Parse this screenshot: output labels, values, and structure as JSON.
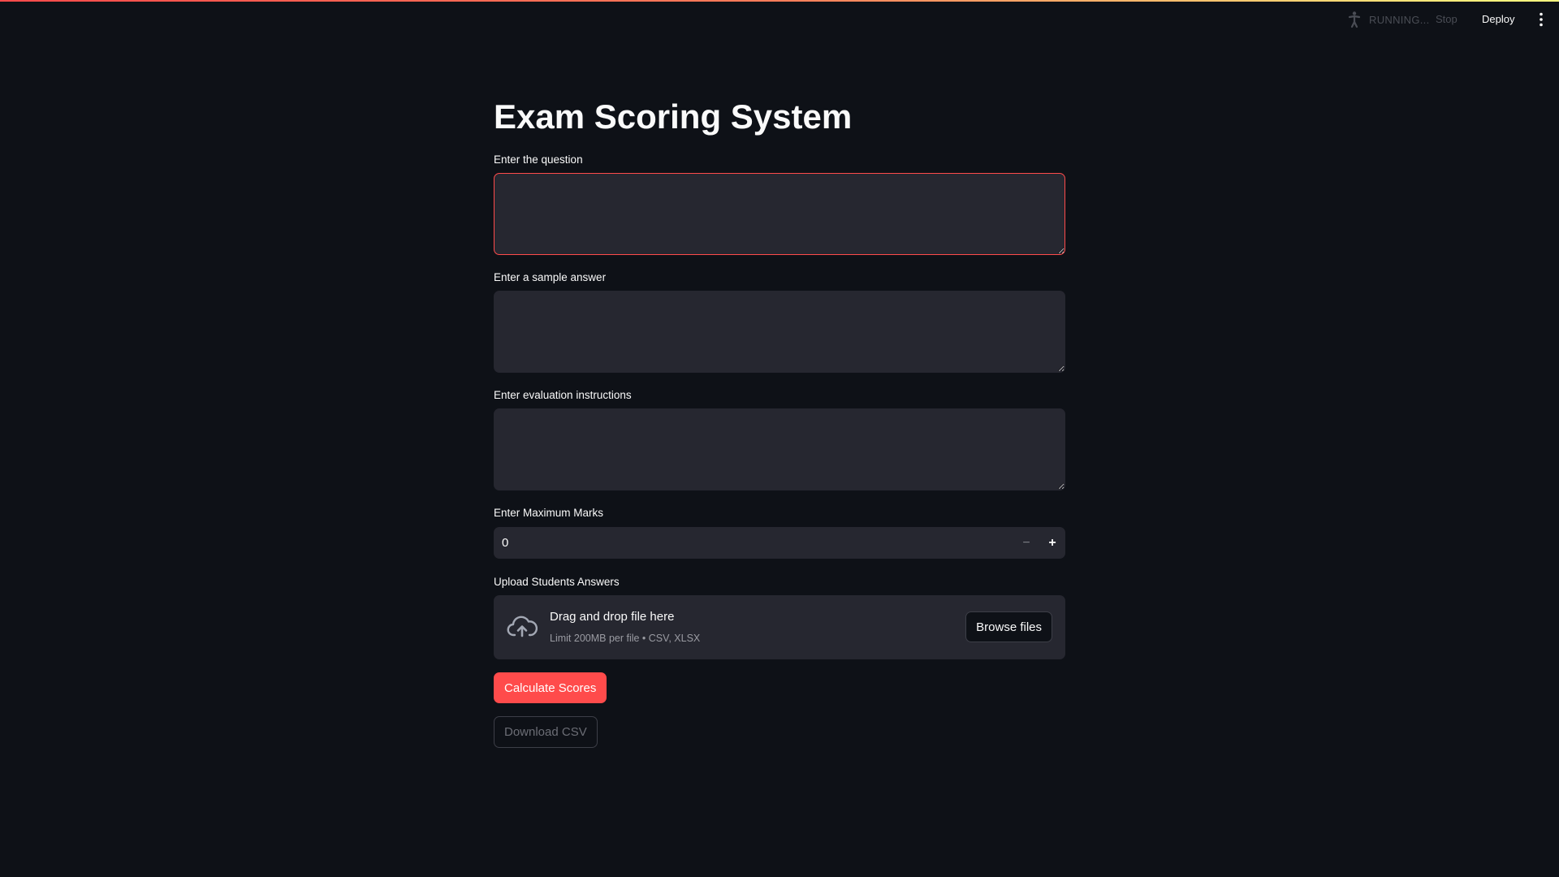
{
  "header": {
    "status_text": "RUNNING...",
    "stop_label": "Stop",
    "deploy_label": "Deploy",
    "status_icon": "running-person-icon",
    "menu_icon": "vertical-ellipsis-icon"
  },
  "main": {
    "title": "Exam Scoring System",
    "question": {
      "label": "Enter the question",
      "value": ""
    },
    "sample_answer": {
      "label": "Enter a sample answer",
      "value": ""
    },
    "instructions": {
      "label": "Enter evaluation instructions",
      "value": ""
    },
    "max_marks": {
      "label": "Enter Maximum Marks",
      "value": "0",
      "decrement_symbol": "−",
      "increment_symbol": "+"
    },
    "uploader": {
      "label": "Upload Students Answers",
      "drop_text": "Drag and drop file here",
      "limit_text": "Limit 200MB per file • CSV, XLSX",
      "browse_label": "Browse files",
      "icon": "cloud-upload-icon"
    },
    "calculate_label": "Calculate Scores",
    "download_label": "Download CSV"
  },
  "colors": {
    "background": "#0e1117",
    "input_background": "#262730",
    "primary": "#ff4b4b",
    "text": "#fafafa",
    "muted_text": "#9a9ba2"
  }
}
